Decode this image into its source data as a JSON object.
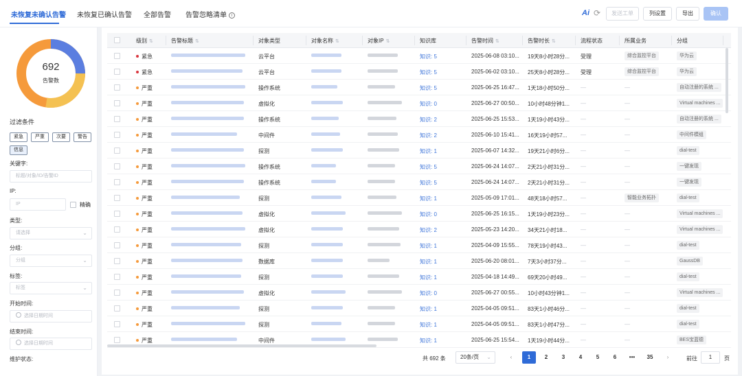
{
  "tabs": [
    {
      "label": "未恢复未确认告警"
    },
    {
      "label": "未恢复已确认告警"
    },
    {
      "label": "全部告警"
    },
    {
      "label": "告警忽略清单"
    }
  ],
  "toolbar": {
    "ai_label": "Ai",
    "create_ticket": "发送工单",
    "column_settings": "列设置",
    "export": "导出",
    "confirm": "确认"
  },
  "summary": {
    "total": "692",
    "total_label": "告警数",
    "donut_colors": {
      "blue": "#5b7ee0",
      "yellow": "#f4c152",
      "orange": "#f59a3b"
    }
  },
  "filters": {
    "title": "过滤条件",
    "levels": [
      "紧急",
      "严重",
      "次要",
      "警告",
      "信息"
    ],
    "keyword_label": "关键字:",
    "keyword_placeholder": "标题/对象/ID/告警ID",
    "ip_label": "IP:",
    "ip_placeholder": "IP",
    "precise_label": "精确",
    "type_label": "类型:",
    "type_placeholder": "请选择",
    "group_label": "分组:",
    "group_placeholder": "分组",
    "tag_label": "标签:",
    "tag_placeholder": "标签",
    "start_label": "开始时间:",
    "start_placeholder": "选择日期时间",
    "end_label": "结束时间:",
    "end_placeholder": "选择日期时间",
    "maintenance_label": "维护状态:"
  },
  "table": {
    "columns": [
      "级别",
      "告警标题",
      "对象类型",
      "对象名称",
      "对象IP",
      "知识库",
      "告警时间",
      "告警时长",
      "流程状态",
      "所属业务",
      "分组"
    ],
    "level_colors": {
      "紧急": "#d9363e",
      "严重": "#f59a3b"
    },
    "rows": [
      {
        "level": "紧急",
        "obj_type": "云平台",
        "kb": "知识: 5",
        "time": "2025-06-08 03:10...",
        "duration": "19天8小时28分...",
        "flow": "受理",
        "biz": "综合监控平台",
        "group": "华为云"
      },
      {
        "level": "紧急",
        "obj_type": "云平台",
        "kb": "知识: 5",
        "time": "2025-06-02 03:10...",
        "duration": "25天8小时28分...",
        "flow": "受理",
        "biz": "综合监控平台",
        "group": "华为云"
      },
      {
        "level": "严重",
        "obj_type": "操作系统",
        "kb": "知识: 5",
        "time": "2025-06-25 16:47...",
        "duration": "1天18小时50分...",
        "flow": "—",
        "biz": "—",
        "group": "自动注册的系统 ..."
      },
      {
        "level": "严重",
        "obj_type": "虚拟化",
        "kb": "知识: 0",
        "time": "2025-06-27 00:50...",
        "duration": "10小时48分钟1...",
        "flow": "—",
        "biz": "—",
        "group": "Virtual machines ..."
      },
      {
        "level": "严重",
        "obj_type": "操作系统",
        "kb": "知识: 2",
        "time": "2025-06-25 15:53...",
        "duration": "1天19小时43分...",
        "flow": "—",
        "biz": "—",
        "group": "自动注册的系统 ..."
      },
      {
        "level": "严重",
        "obj_type": "中间件",
        "kb": "知识: 2",
        "time": "2025-06-10 15:41...",
        "duration": "16天19小时57...",
        "flow": "—",
        "biz": "—",
        "group": "中间件模组"
      },
      {
        "level": "严重",
        "obj_type": "探测",
        "kb": "知识: 1",
        "time": "2025-06-07 14:32...",
        "duration": "19天21小时6分...",
        "flow": "—",
        "biz": "—",
        "group": "dial-test"
      },
      {
        "level": "严重",
        "obj_type": "操作系统",
        "kb": "知识: 5",
        "time": "2025-06-24 14:07...",
        "duration": "2天21小时31分...",
        "flow": "—",
        "biz": "—",
        "group": "一键发现"
      },
      {
        "level": "严重",
        "obj_type": "操作系统",
        "kb": "知识: 5",
        "time": "2025-06-24 14:07...",
        "duration": "2天21小时31分...",
        "flow": "—",
        "biz": "—",
        "group": "一键发现"
      },
      {
        "level": "严重",
        "obj_type": "探测",
        "kb": "知识: 1",
        "time": "2025-05-09 17:01...",
        "duration": "48天18小时57...",
        "flow": "—",
        "biz": "智能业务拓扑",
        "group": "dial-test"
      },
      {
        "level": "严重",
        "obj_type": "虚拟化",
        "kb": "知识: 0",
        "time": "2025-06-25 16:15...",
        "duration": "1天19小时23分...",
        "flow": "—",
        "biz": "—",
        "group": "Virtual machines ..."
      },
      {
        "level": "严重",
        "obj_type": "虚拟化",
        "kb": "知识: 2",
        "time": "2025-05-23 14:20...",
        "duration": "34天21小时18...",
        "flow": "—",
        "biz": "—",
        "group": "Virtual machines ..."
      },
      {
        "level": "严重",
        "obj_type": "探测",
        "kb": "知识: 1",
        "time": "2025-04-09 15:55...",
        "duration": "78天19小时43...",
        "flow": "—",
        "biz": "—",
        "group": "dial-test"
      },
      {
        "level": "严重",
        "obj_type": "数据库",
        "kb": "知识: 1",
        "time": "2025-06-20 08:01...",
        "duration": "7天3小时37分...",
        "flow": "—",
        "biz": "—",
        "group": "GaussDB"
      },
      {
        "level": "严重",
        "obj_type": "探测",
        "kb": "知识: 1",
        "time": "2025-04-18 14:49...",
        "duration": "69天20小时49...",
        "flow": "—",
        "biz": "—",
        "group": "dial-test"
      },
      {
        "level": "严重",
        "obj_type": "虚拟化",
        "kb": "知识: 0",
        "time": "2025-06-27 00:55...",
        "duration": "10小时43分钟1...",
        "flow": "—",
        "biz": "—",
        "group": "Virtual machines ..."
      },
      {
        "level": "严重",
        "obj_type": "探测",
        "kb": "知识: 1",
        "time": "2025-04-05 09:51...",
        "duration": "83天1小时46分...",
        "flow": "—",
        "biz": "—",
        "group": "dial-test"
      },
      {
        "level": "严重",
        "obj_type": "探测",
        "kb": "知识: 1",
        "time": "2025-04-05 09:51...",
        "duration": "83天1小时47分...",
        "flow": "—",
        "biz": "—",
        "group": "dial-test"
      },
      {
        "level": "严重",
        "obj_type": "中间件",
        "kb": "知识: 1",
        "time": "2025-06-25 15:54...",
        "duration": "1天19小时44分...",
        "flow": "—",
        "biz": "—",
        "group": "BES宝蓝德"
      }
    ]
  },
  "pagination": {
    "total": "共 692 条",
    "page_size": "20条/页",
    "pages": [
      "1",
      "2",
      "3",
      "4",
      "5",
      "6",
      "•••",
      "35"
    ],
    "current": "1",
    "goto_label": "前往",
    "goto_value": "1",
    "page_unit": "页"
  }
}
